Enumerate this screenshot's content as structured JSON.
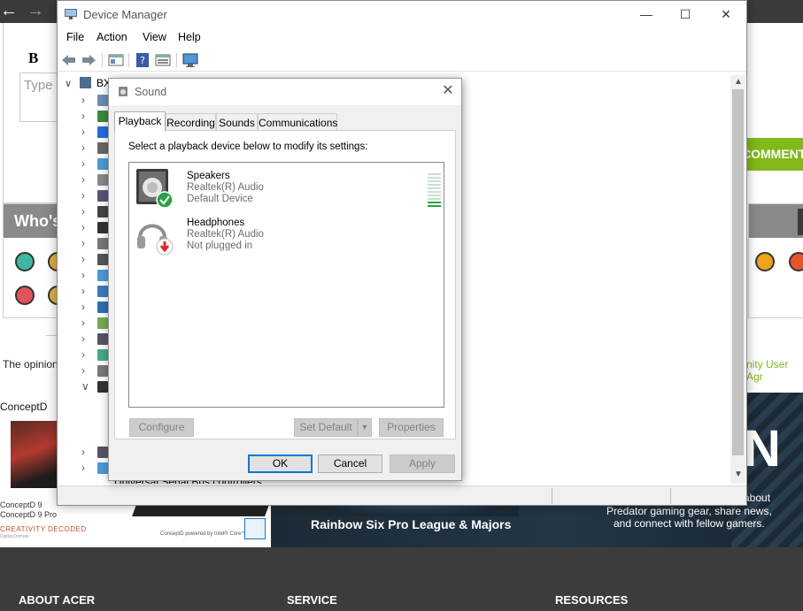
{
  "background_page": {
    "editor": {
      "bold_label": "B",
      "textarea_placeholder": "Type y"
    },
    "comment_button": "COMMENT",
    "whos_online_title": "Who's",
    "disclaimer_text": "The opinion",
    "agreement_text": "nity User Agr",
    "concept_ad": {
      "brand": "ConceptD",
      "line1": "ConceptD 9",
      "line2": "ConceptD 9 Pro",
      "tagline": "CREATIVITY DECODED",
      "small": "Digital Domain",
      "powered": "ConceptD powered by Intel® Core™ i9"
    },
    "predator_ad": {
      "headline": "Rainbow Six Pro League & Majors",
      "about": "about",
      "gear_line": "Predator gaming gear, share news,",
      "connect_line": "and connect with fellow gamers.",
      "big_letter": "N"
    },
    "footer": {
      "col1": "ABOUT ACER",
      "col2": "SERVICE",
      "col3": "RESOURCES"
    }
  },
  "device_manager": {
    "title": "Device Manager",
    "menu": [
      "File",
      "Action",
      "View",
      "Help"
    ],
    "root_label": "BX",
    "last_category": "Universal Serial Bus controllers",
    "window_controls": {
      "minimize": "—",
      "maximize": "☐",
      "close": "✕"
    }
  },
  "sound_dialog": {
    "title": "Sound",
    "close_glyph": "✕",
    "tabs": [
      "Playback",
      "Recording",
      "Sounds",
      "Communications"
    ],
    "active_tab": "Playback",
    "instruction": "Select a playback device below to modify its settings:",
    "devices": [
      {
        "name": "Speakers",
        "driver": "Realtek(R) Audio",
        "status": "Default Device",
        "badge": "check-icon",
        "level_fraction": 0.2
      },
      {
        "name": "Headphones",
        "driver": "Realtek(R) Audio",
        "status": "Not plugged in",
        "badge": "down-arrow-icon"
      }
    ],
    "buttons": {
      "configure": "Configure",
      "set_default": "Set Default",
      "properties": "Properties",
      "ok": "OK",
      "cancel": "Cancel",
      "apply": "Apply"
    }
  },
  "colors": {
    "accent_green": "#83b81a",
    "default_check": "#2aa146",
    "unplugged_red": "#d72b2b",
    "focus_blue": "#0078d7"
  }
}
